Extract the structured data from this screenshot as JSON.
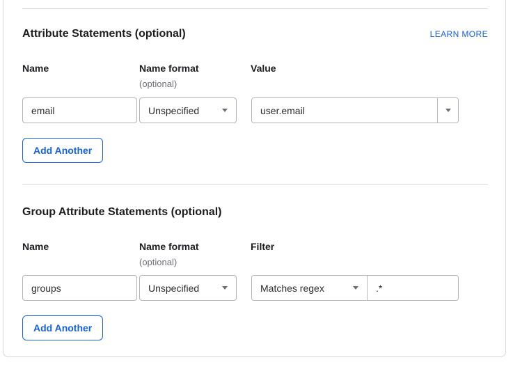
{
  "colors": {
    "accent_blue": "#1662dd",
    "card_border": "#d8d8da",
    "input_border": "#b3b3b8",
    "text": "#1d1d21",
    "muted_text": "#6e6e78"
  },
  "attribute_section": {
    "title": "Attribute Statements (optional)",
    "learn_more_label": "LEARN MORE",
    "headers": {
      "name": "Name",
      "name_format": "Name format",
      "value": "Value"
    },
    "name_format_note": "(optional)",
    "row": {
      "name": "email",
      "name_format_selected": "Unspecified",
      "value": "user.email"
    },
    "add_button_label": "Add Another"
  },
  "group_section": {
    "title": "Group Attribute Statements (optional)",
    "headers": {
      "name": "Name",
      "name_format": "Name format",
      "filter": "Filter"
    },
    "name_format_note": "(optional)",
    "row": {
      "name": "groups",
      "name_format_selected": "Unspecified",
      "filter_type_selected": "Matches regex",
      "filter_value": ".*"
    },
    "add_button_label": "Add Another"
  }
}
